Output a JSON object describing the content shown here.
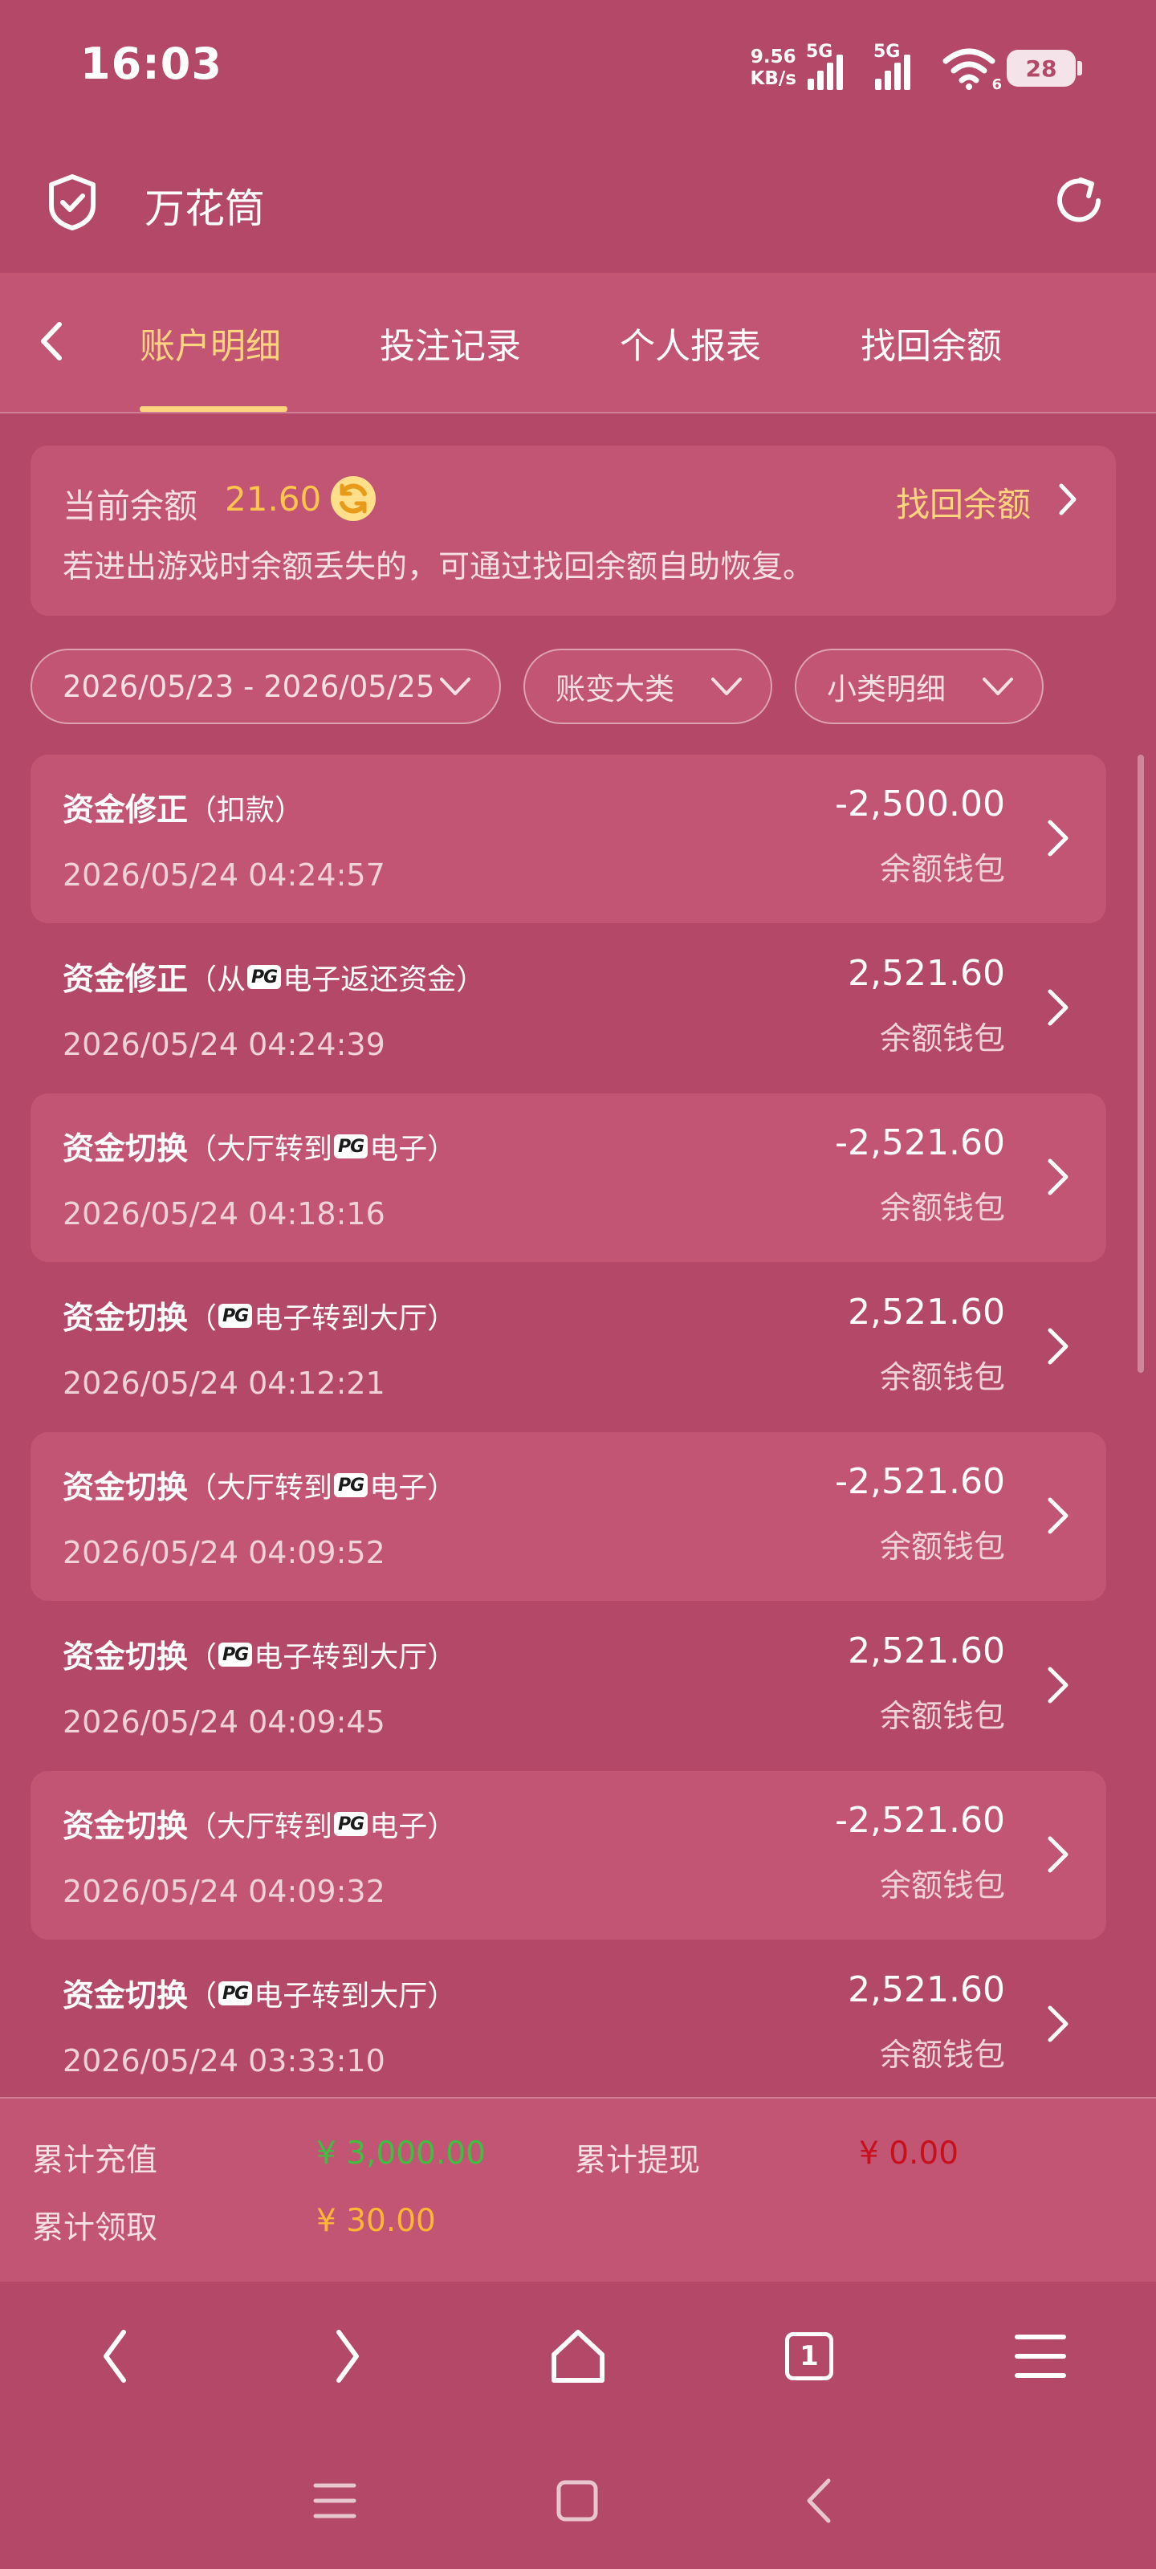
{
  "status_bar": {
    "time": "16:03",
    "net_speed_value": "9.56",
    "net_speed_unit": "KB/s",
    "signal1_label": "5G",
    "signal2_label": "5G",
    "wifi_label": "6",
    "battery": "28"
  },
  "app_header": {
    "title": "万花筒"
  },
  "tabs": [
    {
      "label": "账户明细",
      "active": true
    },
    {
      "label": "投注记录",
      "active": false
    },
    {
      "label": "个人报表",
      "active": false
    },
    {
      "label": "找回余额",
      "active": false
    }
  ],
  "balance": {
    "label": "当前余额",
    "value": "21.60",
    "find_link": "找回余额",
    "tip": "若进出游戏时余额丢失的，可通过找回余额自助恢复。"
  },
  "filters": {
    "date_range": "2026/05/23 - 2026/05/25",
    "category": "账变大类",
    "subcategory": "小类明细"
  },
  "transactions": [
    {
      "title": "资金修正",
      "pre": "（扣款）",
      "pg": "",
      "post": "",
      "time": "2026/05/24 04:24:57",
      "amount": "-2,500.00",
      "wallet": "余额钱包"
    },
    {
      "title": "资金修正",
      "pre": "（从",
      "pg": "PG",
      "post": "电子返还资金）",
      "time": "2026/05/24 04:24:39",
      "amount": "2,521.60",
      "wallet": "余额钱包"
    },
    {
      "title": "资金切换",
      "pre": "（大厅转到",
      "pg": "PG",
      "post": "电子）",
      "time": "2026/05/24 04:18:16",
      "amount": "-2,521.60",
      "wallet": "余额钱包"
    },
    {
      "title": "资金切换",
      "pre": "（",
      "pg": "PG",
      "post": "电子转到大厅）",
      "time": "2026/05/24 04:12:21",
      "amount": "2,521.60",
      "wallet": "余额钱包"
    },
    {
      "title": "资金切换",
      "pre": "（大厅转到",
      "pg": "PG",
      "post": "电子）",
      "time": "2026/05/24 04:09:52",
      "amount": "-2,521.60",
      "wallet": "余额钱包"
    },
    {
      "title": "资金切换",
      "pre": "（",
      "pg": "PG",
      "post": "电子转到大厅）",
      "time": "2026/05/24 04:09:45",
      "amount": "2,521.60",
      "wallet": "余额钱包"
    },
    {
      "title": "资金切换",
      "pre": "（大厅转到",
      "pg": "PG",
      "post": "电子）",
      "time": "2026/05/24 04:09:32",
      "amount": "-2,521.60",
      "wallet": "余额钱包"
    },
    {
      "title": "资金切换",
      "pre": "（",
      "pg": "PG",
      "post": "电子转到大厅）",
      "time": "2026/05/24 03:33:10",
      "amount": "2,521.60",
      "wallet": "余额钱包"
    }
  ],
  "summary": {
    "recharge_label": "累计充值",
    "recharge_value": "¥ 3,000.00",
    "withdraw_label": "累计提现",
    "withdraw_value": "¥ 0.00",
    "claim_label": "累计领取",
    "claim_value": "¥ 30.00"
  },
  "browser_nav": {
    "tab_count": "1"
  },
  "colors": {
    "background": "#b44868",
    "card": "#c25574",
    "accent_gold": "#ffd47e",
    "balance_orange": "#ffc54d",
    "recharge_green": "#3fbf3f",
    "withdraw_red": "#c8101c",
    "claim_orange": "#ffb733"
  }
}
